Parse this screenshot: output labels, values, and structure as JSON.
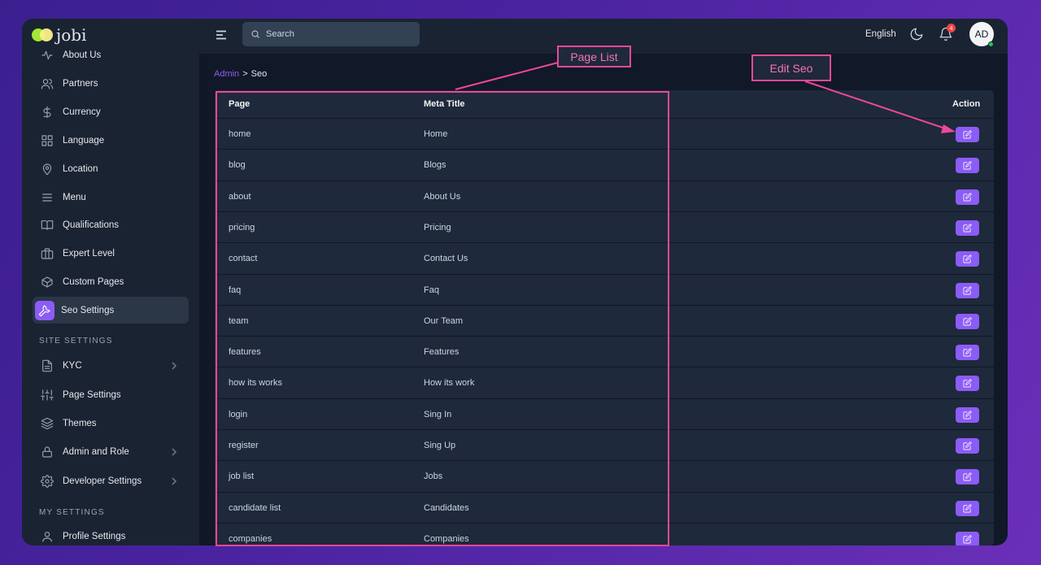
{
  "app": {
    "logo_text": "jobi"
  },
  "sidebar": {
    "items": [
      {
        "label": "About Us",
        "icon": "pulse-icon"
      },
      {
        "label": "Partners",
        "icon": "users-icon"
      },
      {
        "label": "Currency",
        "icon": "dollar-icon"
      },
      {
        "label": "Language",
        "icon": "grid-icon"
      },
      {
        "label": "Location",
        "icon": "map-pin-icon"
      },
      {
        "label": "Menu",
        "icon": "menu-icon"
      },
      {
        "label": "Qualifications",
        "icon": "book-icon"
      },
      {
        "label": "Expert Level",
        "icon": "briefcase-icon"
      },
      {
        "label": "Custom Pages",
        "icon": "box-icon"
      },
      {
        "label": "Seo Settings",
        "icon": "wrench-icon",
        "active": true
      }
    ],
    "site_settings_title": "SITE SETTINGS",
    "site_items": [
      {
        "label": "KYC",
        "icon": "document-icon",
        "has_children": true
      },
      {
        "label": "Page Settings",
        "icon": "sliders-icon"
      },
      {
        "label": "Themes",
        "icon": "layers-icon"
      },
      {
        "label": "Admin and Role",
        "icon": "lock-icon",
        "has_children": true
      },
      {
        "label": "Developer Settings",
        "icon": "gear-icon",
        "has_children": true
      }
    ],
    "my_settings_title": "MY SETTINGS",
    "my_items": [
      {
        "label": "Profile Settings",
        "icon": "user-icon"
      }
    ]
  },
  "topbar": {
    "search_placeholder": "Search",
    "language": "English",
    "notification_count": "4",
    "avatar_initials": "AD"
  },
  "breadcrumb": {
    "parent": "Admin",
    "separator": ">",
    "current": "Seo"
  },
  "table": {
    "columns": [
      "Page",
      "Meta Title",
      "Action"
    ],
    "rows": [
      {
        "page": "home",
        "meta_title": "Home"
      },
      {
        "page": "blog",
        "meta_title": "Blogs"
      },
      {
        "page": "about",
        "meta_title": "About Us"
      },
      {
        "page": "pricing",
        "meta_title": "Pricing"
      },
      {
        "page": "contact",
        "meta_title": "Contact Us"
      },
      {
        "page": "faq",
        "meta_title": "Faq"
      },
      {
        "page": "team",
        "meta_title": "Our Team"
      },
      {
        "page": "features",
        "meta_title": "Features"
      },
      {
        "page": "how its works",
        "meta_title": "How its work"
      },
      {
        "page": "login",
        "meta_title": "Sing In"
      },
      {
        "page": "register",
        "meta_title": "Sing Up"
      },
      {
        "page": "job list",
        "meta_title": "Jobs"
      },
      {
        "page": "candidate list",
        "meta_title": "Candidates"
      },
      {
        "page": "companies",
        "meta_title": "Companies"
      }
    ]
  },
  "annotations": {
    "page_list_label": "Page List",
    "edit_seo_label": "Edit Seo",
    "color": "#ec4899"
  },
  "colors": {
    "accent": "#8b5cf6",
    "background": "#111827",
    "panel": "#1e293b",
    "sidebar": "#1a2332"
  }
}
